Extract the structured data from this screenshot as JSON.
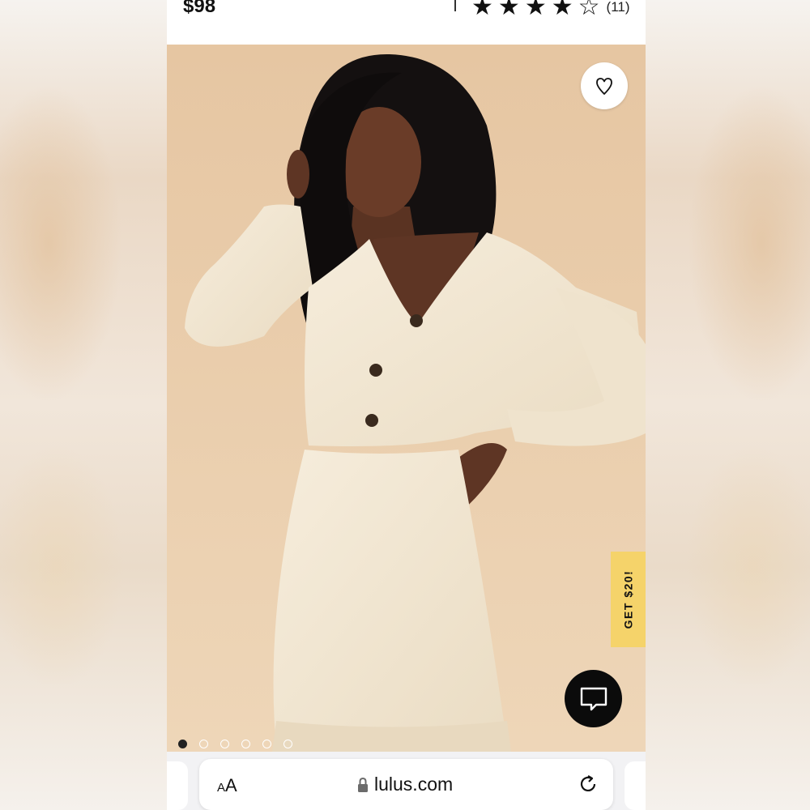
{
  "product": {
    "price": "$98",
    "rating": 4,
    "rating_max": 5,
    "review_count": "(11)"
  },
  "hero": {
    "image_description": "model wearing cream fuzzy cardigan and mini skirt set",
    "promo_tab_label": "GET $20!",
    "carousel_dot_count": 6,
    "carousel_active_index": 0
  },
  "browser": {
    "text_size_label_small": "A",
    "text_size_label_large": "A",
    "url": "lulus.com"
  },
  "colors": {
    "accent_yellow": "#f5d36a",
    "hero_background": "#e9cba8",
    "garment_cream": "#f3e9d6",
    "chat_button": "#0b0b0b"
  },
  "icons": {
    "favorite": "heart-outline-icon",
    "chat": "chat-bubble-icon",
    "lock": "lock-icon",
    "reload": "reload-icon"
  }
}
